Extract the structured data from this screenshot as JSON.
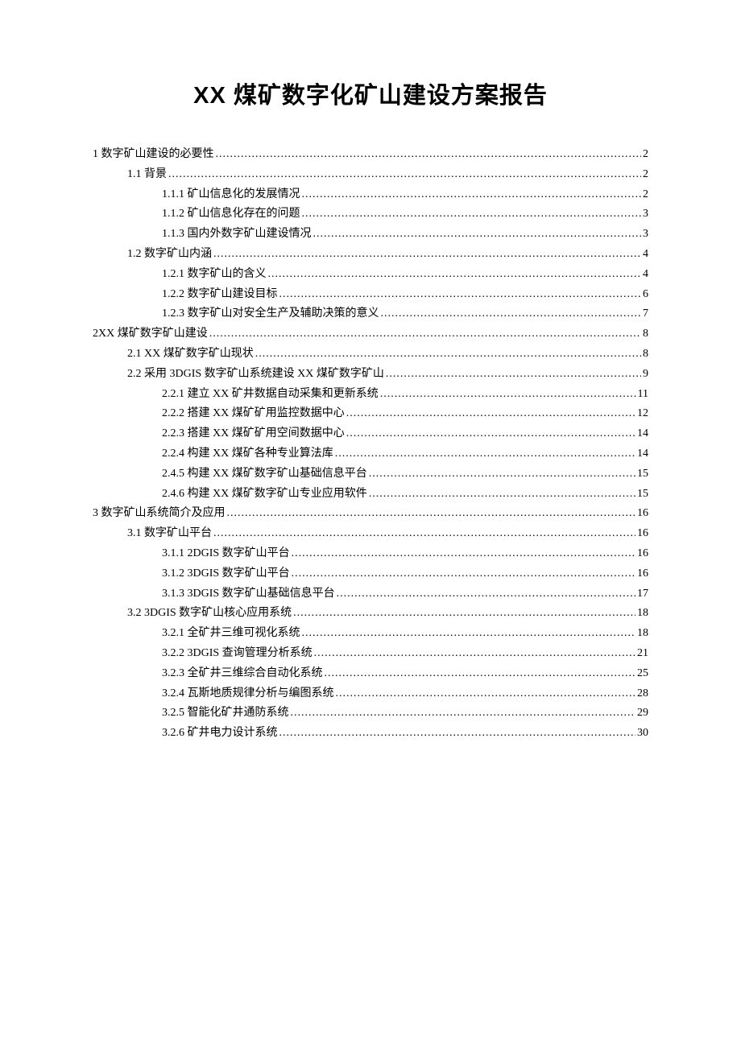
{
  "title": "XX 煤矿数字化矿山建设方案报告",
  "toc": [
    {
      "level": 1,
      "label": "1 数字矿山建设的必要性",
      "page": "2"
    },
    {
      "level": 2,
      "label": "1.1 背景",
      "page": "2"
    },
    {
      "level": 3,
      "label": "1.1.1 矿山信息化的发展情况",
      "page": "2"
    },
    {
      "level": 3,
      "label": "1.1.2 矿山信息化存在的问题",
      "page": "3"
    },
    {
      "level": 3,
      "label": "1.1.3 国内外数字矿山建设情况",
      "page": "3"
    },
    {
      "level": 2,
      "label": "1.2 数字矿山内涵",
      "page": "4"
    },
    {
      "level": 3,
      "label": "1.2.1 数字矿山的含义",
      "page": "4"
    },
    {
      "level": 3,
      "label": "1.2.2 数字矿山建设目标",
      "page": "6"
    },
    {
      "level": 3,
      "label": "1.2.3 数字矿山对安全生产及辅助决策的意义",
      "page": "7"
    },
    {
      "level": 1,
      "label": "2XX 煤矿数字矿山建设",
      "page": "8"
    },
    {
      "level": 2,
      "label": "2.1 XX 煤矿数字矿山现状",
      "page": "8"
    },
    {
      "level": 2,
      "label": "2.2 采用 3DGIS 数字矿山系统建设 XX 煤矿数字矿山 ",
      "page": "9"
    },
    {
      "level": 3,
      "label": "2.2.1 建立 XX 矿井数据自动采集和更新系统",
      "page": "11"
    },
    {
      "level": 3,
      "label": "2.2.2 搭建 XX 煤矿矿用监控数据中心",
      "page": "12"
    },
    {
      "level": 3,
      "label": "2.2.3 搭建 XX 煤矿矿用空间数据中心",
      "page": "14"
    },
    {
      "level": 3,
      "label": "2.2.4 构建 XX 煤矿各种专业算法库",
      "page": "14"
    },
    {
      "level": 3,
      "label": "2.4.5 构建 XX 煤矿数字矿山基础信息平台",
      "page": "15"
    },
    {
      "level": 3,
      "label": "2.4.6 构建 XX 煤矿数字矿山专业应用软件",
      "page": "15"
    },
    {
      "level": 1,
      "label": "3 数字矿山系统简介及应用",
      "page": "16"
    },
    {
      "level": 2,
      "label": "3.1 数字矿山平台",
      "page": "16"
    },
    {
      "level": 3,
      "label": "3.1.1 2DGIS 数字矿山平台 ",
      "page": "16"
    },
    {
      "level": 3,
      "label": "3.1.2 3DGIS 数字矿山平台 ",
      "page": "16"
    },
    {
      "level": 3,
      "label": "3.1.3 3DGIS 数字矿山基础信息平台 ",
      "page": "17"
    },
    {
      "level": 2,
      "label": "3.2 3DGIS 数字矿山核心应用系统 ",
      "page": "18"
    },
    {
      "level": 3,
      "label": "3.2.1 全矿井三维可视化系统",
      "page": "18"
    },
    {
      "level": 3,
      "label": "3.2.2   3DGIS 查询管理分析系统 ",
      "page": "21"
    },
    {
      "level": 3,
      "label": "3.2.3 全矿井三维综合自动化系统",
      "page": "25"
    },
    {
      "level": 3,
      "label": "3.2.4 瓦斯地质规律分析与编图系统",
      "page": "28"
    },
    {
      "level": 3,
      "label": "3.2.5 智能化矿井通防系统",
      "page": "29"
    },
    {
      "level": 3,
      "label": "3.2.6 矿井电力设计系统",
      "page": "30"
    }
  ]
}
